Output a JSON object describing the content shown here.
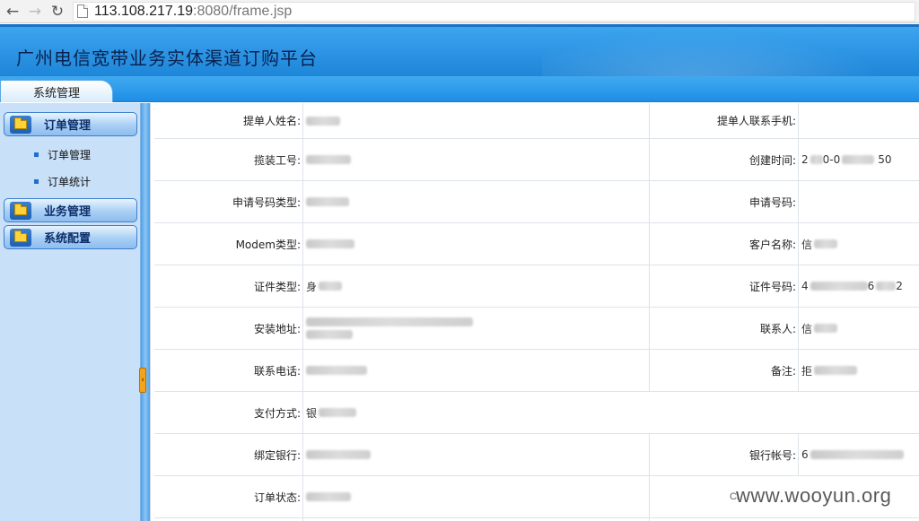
{
  "browser": {
    "url_host": "113.108.217.19",
    "url_rest": ":8080/frame.jsp"
  },
  "app": {
    "title": "广州电信宽带业务实体渠道订购平台",
    "tab": "系统管理"
  },
  "sidebar": {
    "groups": [
      {
        "label": "订单管理",
        "sub": [
          "订单管理",
          "订单统计"
        ]
      },
      {
        "label": "业务管理"
      },
      {
        "label": "系统配置"
      }
    ]
  },
  "form": {
    "rows": [
      {
        "l1": "提单人姓名:",
        "l2": "提单人联系手机:"
      },
      {
        "l1": "揽装工号:",
        "l2": "创建时间:",
        "v2_prefix": "2",
        "v2_mid": "0-0",
        "v2_suffix": "50"
      },
      {
        "l1": "申请号码类型:",
        "l2": "申请号码:"
      },
      {
        "l1": "Modem类型:",
        "l2": "客户名称:",
        "v2_prefix": "信"
      },
      {
        "l1": "证件类型:",
        "l2": "证件号码:",
        "v1_prefix": "身",
        "v2_prefix": "4",
        "v2_suffix": "6",
        "v2_end": "2"
      },
      {
        "l1": "安装地址:",
        "l2": "联系人:",
        "v2_prefix": "信"
      },
      {
        "l1": "联系电话:",
        "l2": "备注:",
        "v2_prefix": "拒"
      },
      {
        "l1": "支付方式:",
        "v1_prefix": "银"
      },
      {
        "l1": "绑定银行:",
        "l2": "银行帐号:",
        "v2_prefix": "6"
      },
      {
        "l1": "订单状态:",
        "l2": "CV"
      }
    ]
  },
  "watermark": "www.wooyun.org",
  "watermark_overlay": "Ci"
}
